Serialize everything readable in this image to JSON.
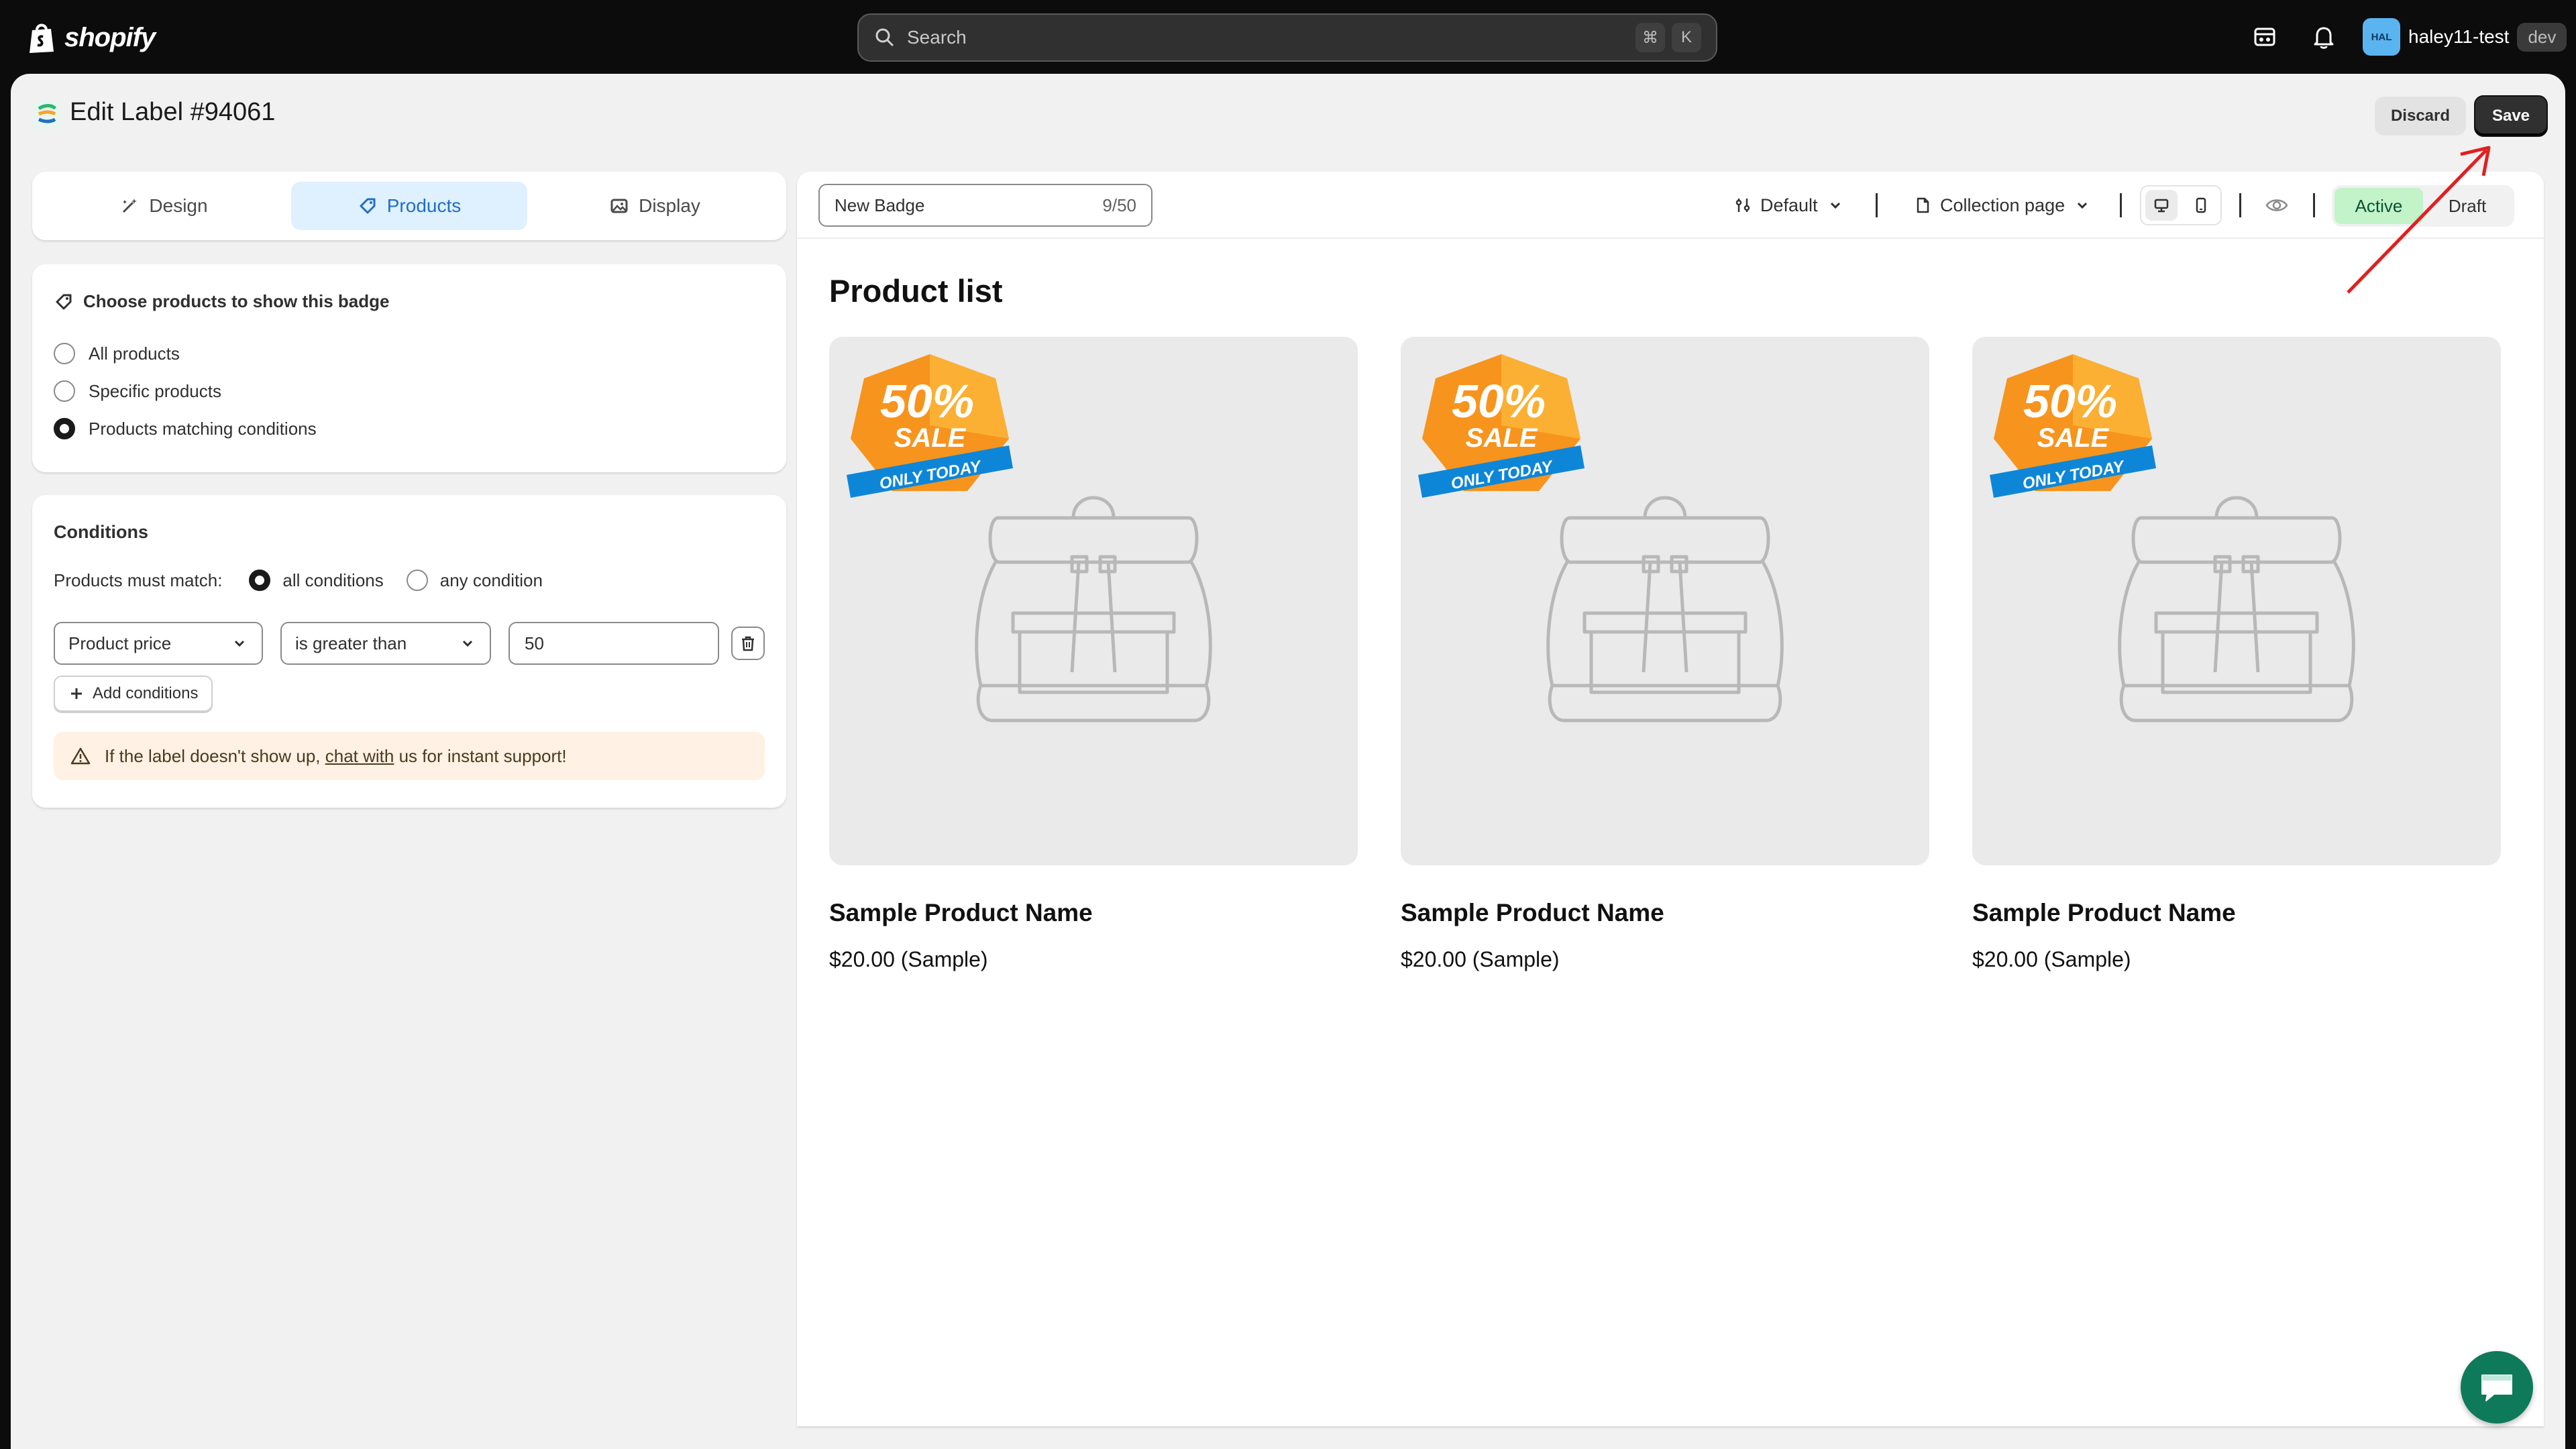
{
  "topbar": {
    "brand": "shopify",
    "search_placeholder": "Search",
    "shortcut_keys": [
      "⌘",
      "K"
    ],
    "user": {
      "initials": "HAL",
      "name": "haley11-test",
      "badge": "dev"
    }
  },
  "page": {
    "title": "Edit Label #94061",
    "discard_label": "Discard",
    "save_label": "Save"
  },
  "tabs": [
    {
      "label": "Design",
      "icon": "magic-wand-icon"
    },
    {
      "label": "Products",
      "icon": "tag-icon",
      "active": true
    },
    {
      "label": "Display",
      "icon": "image-icon"
    }
  ],
  "choose": {
    "heading": "Choose products to show this badge",
    "options": [
      "All products",
      "Specific products",
      "Products matching conditions"
    ],
    "selected": 2
  },
  "conditions": {
    "title": "Conditions",
    "match_label": "Products must match:",
    "match_options": [
      "all conditions",
      "any condition"
    ],
    "match_selected": 0,
    "field": "Product price",
    "operator": "is greater than",
    "value": "50",
    "add_label": "Add conditions",
    "warning_before": "If the label doesn't show up,",
    "warning_link": "chat with",
    "warning_after": "us for instant support!"
  },
  "preview": {
    "badge_name": "New Badge",
    "badge_count": "9/50",
    "theme": "Default",
    "page_type": "Collection page",
    "status_options": [
      "Active",
      "Draft"
    ],
    "status_selected": 0,
    "list_title": "Product list",
    "products": [
      {
        "name": "Sample Product Name",
        "price": "$20.00 (Sample)"
      },
      {
        "name": "Sample Product Name",
        "price": "$20.00 (Sample)"
      },
      {
        "name": "Sample Product Name",
        "price": "$20.00 (Sample)"
      }
    ],
    "sale_badge": {
      "line1": "50%",
      "line2": "SALE",
      "ribbon": "ONLY TODAY"
    }
  },
  "colors": {
    "accent_blue": "#1f6fc4",
    "active_green": "#c2f3c9",
    "sale_orange": "#f7941d",
    "ribbon_blue": "#0d86d8",
    "annotation_red": "#e02020"
  }
}
